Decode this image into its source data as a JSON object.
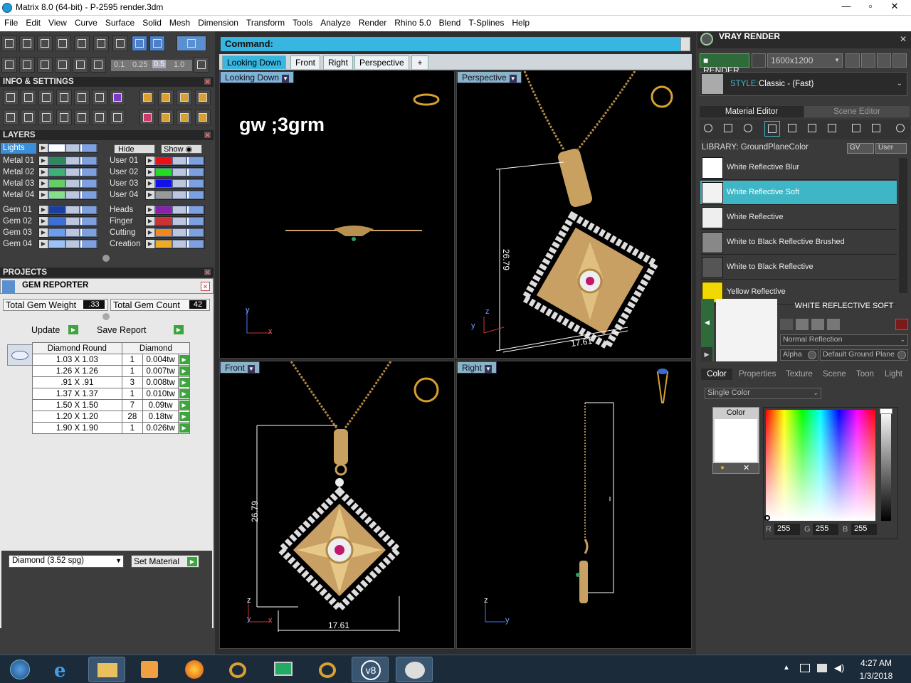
{
  "window": {
    "title": "Matrix 8.0 (64-bit) - P-2595 render.3dm",
    "min": "—",
    "max": "▫",
    "close": "✕"
  },
  "menu": [
    "File",
    "Edit",
    "View",
    "Curve",
    "Surface",
    "Solid",
    "Mesh",
    "Dimension",
    "Transform",
    "Tools",
    "Analyze",
    "Render",
    "Rhino 5.0",
    "Blend",
    "T-Splines",
    "Help"
  ],
  "toolbar": {
    "snap_values": [
      "0.1",
      "0.25",
      "0.5",
      "1.0"
    ]
  },
  "info_settings": {
    "title": "INFO & SETTINGS"
  },
  "layers": {
    "title": "LAYERS",
    "lights_label": "Lights",
    "hide_label": "Hide",
    "show_label": "Show",
    "left": [
      {
        "name": "Metal 01",
        "color": "#2e8b57"
      },
      {
        "name": "Metal 02",
        "color": "#3cb371"
      },
      {
        "name": "Metal 03",
        "color": "#66cc66"
      },
      {
        "name": "Metal 04",
        "color": "#88dd88"
      },
      {
        "name": "Gem 01",
        "color": "#1a3fa0"
      },
      {
        "name": "Gem 02",
        "color": "#3c6fd8"
      },
      {
        "name": "Gem 03",
        "color": "#6a9ff0"
      },
      {
        "name": "Gem 04",
        "color": "#9cc1f5"
      }
    ],
    "right": [
      {
        "name": "User 01",
        "color": "#ee1111"
      },
      {
        "name": "User 02",
        "color": "#22dd22"
      },
      {
        "name": "User 03",
        "color": "#1111ee"
      },
      {
        "name": "User 04",
        "color": "#999999"
      },
      {
        "name": "Heads",
        "color": "#8822aa"
      },
      {
        "name": "Finger",
        "color": "#cc3333"
      },
      {
        "name": "Cutting",
        "color": "#ee8822"
      },
      {
        "name": "Creation",
        "color": "#eeaa22"
      }
    ]
  },
  "projects": {
    "title": "PROJECTS"
  },
  "gem_reporter": {
    "title": "GEM REPORTER",
    "total_weight_label": "Total Gem Weight",
    "total_weight": ".33",
    "total_count_label": "Total Gem Count",
    "total_count": "42",
    "update_label": "Update",
    "save_label": "Save Report",
    "col1": "Diamond Round",
    "col2": "Diamond",
    "rows": [
      {
        "size": "1.03 X 1.03",
        "qty": "1",
        "wt": "0.004tw"
      },
      {
        "size": "1.26 X 1.26",
        "qty": "1",
        "wt": "0.007tw"
      },
      {
        "size": ".91 X .91",
        "qty": "3",
        "wt": "0.008tw"
      },
      {
        "size": "1.37 X 1.37",
        "qty": "1",
        "wt": "0.010tw"
      },
      {
        "size": "1.50 X 1.50",
        "qty": "7",
        "wt": "0.09tw"
      },
      {
        "size": "1.20 X 1.20",
        "qty": "28",
        "wt": "0.18tw"
      },
      {
        "size": "1.90 X 1.90",
        "qty": "1",
        "wt": "0.026tw"
      }
    ],
    "material_select": "Diamond     (3.52 spg)",
    "set_material_label": "Set Material"
  },
  "command": {
    "label": "Command:"
  },
  "view_tabs": [
    "Looking Down",
    "Front",
    "Right",
    "Perspective",
    "+"
  ],
  "viewports": {
    "top_left": {
      "label": "Looking Down",
      "annotation": "gw ;3grm"
    },
    "top_right": {
      "label": "Perspective",
      "dim_height": "26.79",
      "dim_width": "17.61"
    },
    "bottom_left": {
      "label": "Front",
      "dim_height": "26.79",
      "dim_width": "17.61"
    },
    "bottom_right": {
      "label": "Right"
    },
    "axes": {
      "x": "x",
      "y": "y",
      "z": "z"
    }
  },
  "vray": {
    "title": "VRAY RENDER",
    "render_label": "RENDER",
    "resolution": "1600x1200",
    "style_label": "STYLE:",
    "style_value": "Classic - (Fast)",
    "tab_material": "Material Editor",
    "tab_scene": "Scene Editor",
    "library_label": "LIBRARY: GroundPlaneColor",
    "gv_label": "GV",
    "user_label": "User",
    "materials": [
      {
        "name": "White Reflective Blur",
        "color": "#ffffff"
      },
      {
        "name": "White Reflective Soft",
        "color": "#f2f2f2"
      },
      {
        "name": "White Reflective",
        "color": "#eeeeee"
      },
      {
        "name": "White to Black Reflective Brushed",
        "color": "#888888"
      },
      {
        "name": "White to Black Reflective",
        "color": "#555555"
      },
      {
        "name": "Yellow Reflective",
        "color": "#f0d800"
      }
    ],
    "selected_name": "WHITE REFLECTIVE SOFT",
    "reflection_mode": "Normal Reflection",
    "alpha_label": "Alpha",
    "ground_plane": "Default Ground Plane",
    "subtabs": [
      "Color",
      "Properties",
      "Texture",
      "Scene",
      "Toon",
      "Light"
    ],
    "color_mode": "Single Color",
    "color_box_label": "Color",
    "r_label": "R",
    "r": "255",
    "g_label": "G",
    "g": "255",
    "b_label": "B",
    "b": "255"
  },
  "clock": {
    "time": "4:27 AM",
    "date": "1/3/2018"
  }
}
